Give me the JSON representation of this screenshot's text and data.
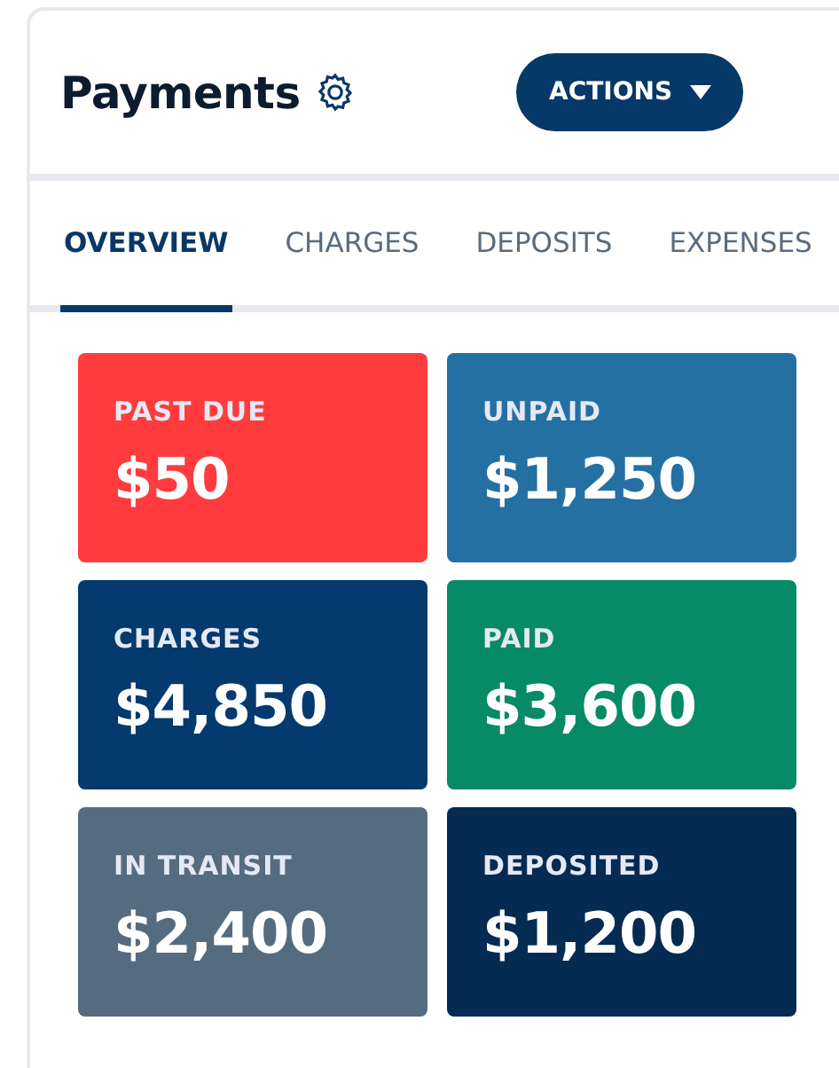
{
  "header": {
    "title": "Payments",
    "actions_button": "ACTIONS"
  },
  "tabs": [
    {
      "label": "OVERVIEW",
      "selected": true
    },
    {
      "label": "CHARGES",
      "selected": false
    },
    {
      "label": "DEPOSITS",
      "selected": false
    },
    {
      "label": "EXPENSES",
      "selected": false
    }
  ],
  "tiles": [
    {
      "label": "PAST DUE",
      "amount": "$50",
      "color": "#ff3b3d"
    },
    {
      "label": "UNPAID",
      "amount": "$1,250",
      "color": "#2570a3"
    },
    {
      "label": "CHARGES",
      "amount": "$4,850",
      "color": "#043a6e"
    },
    {
      "label": "PAID",
      "amount": "$3,600",
      "color": "#078a66"
    },
    {
      "label": "IN TRANSIT",
      "amount": "$2,400",
      "color": "#556b80"
    },
    {
      "label": "DEPOSITED",
      "amount": "$1,200",
      "color": "#052b52"
    }
  ]
}
